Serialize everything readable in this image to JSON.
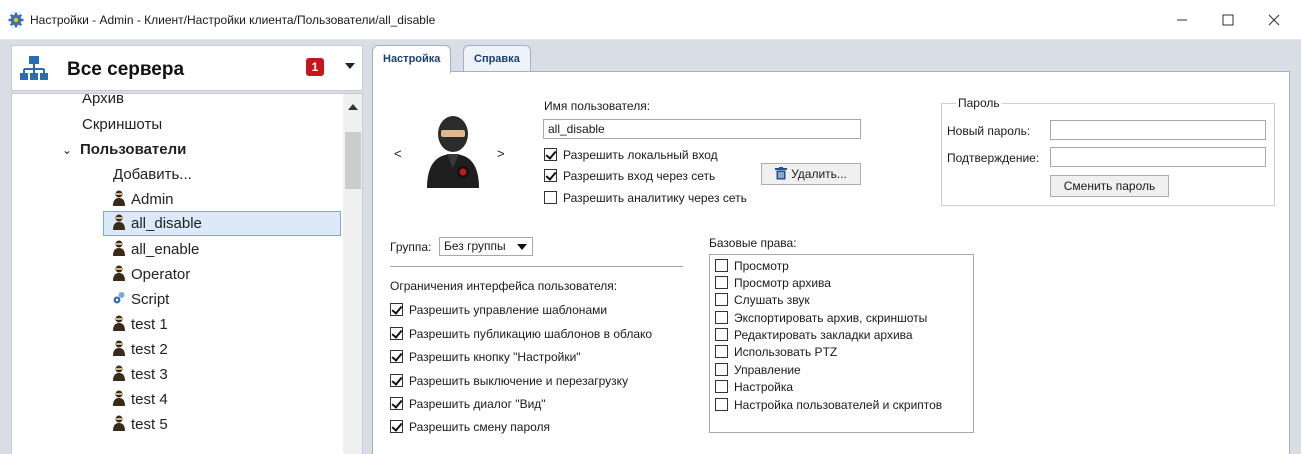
{
  "window": {
    "title": "Настройки - Admin - Клиент/Настройки клиента/Пользователи/all_disable"
  },
  "server_panel": {
    "title": "Все сервера",
    "badge": "1"
  },
  "tree": {
    "items": [
      {
        "label": "Архив"
      },
      {
        "label": "Скриншоты"
      },
      {
        "label": "Пользователи"
      },
      {
        "label": "Добавить..."
      },
      {
        "label": "Admin"
      },
      {
        "label": "all_disable"
      },
      {
        "label": "all_enable"
      },
      {
        "label": "Operator"
      },
      {
        "label": "Script"
      },
      {
        "label": "test 1"
      },
      {
        "label": "test 2"
      },
      {
        "label": "test 3"
      },
      {
        "label": "test 4"
      },
      {
        "label": "test 5"
      }
    ]
  },
  "tabs": [
    {
      "label": "Настройка"
    },
    {
      "label": "Справка"
    }
  ],
  "user": {
    "name_label": "Имя пользователя:",
    "name_value": "all_disable",
    "prev": "<",
    "next": ">",
    "allow_local_login": "Разрешить локальный вход",
    "allow_network_login": "Разрешить вход через сеть",
    "allow_network_analytics": "Разрешить аналитику через сеть",
    "delete_button": "Удалить..."
  },
  "password": {
    "group_title": "Пароль",
    "new_label": "Новый пароль:",
    "confirm_label": "Подтверждение:",
    "change_button": "Сменить пароль"
  },
  "group": {
    "label": "Группа:",
    "value": "Без группы"
  },
  "ui_limits": {
    "title": "Ограничения интерфейса пользователя:",
    "items": [
      {
        "label": "Разрешить управление шаблонами",
        "checked": true
      },
      {
        "label": "Разрешить публикацию шаблонов в облако",
        "checked": true
      },
      {
        "label": "Разрешить кнопку \"Настройки\"",
        "checked": true
      },
      {
        "label": "Разрешить выключение и перезагрузку",
        "checked": true
      },
      {
        "label": "Разрешить диалог \"Вид\"",
        "checked": true
      },
      {
        "label": "Разрешить смену пароля",
        "checked": true
      }
    ]
  },
  "base_rights": {
    "title": "Базовые права:",
    "items": [
      {
        "label": "Просмотр"
      },
      {
        "label": "Просмотр архива"
      },
      {
        "label": "Слушать звук"
      },
      {
        "label": "Экспортировать архив, скриншоты"
      },
      {
        "label": "Редактировать закладки архива"
      },
      {
        "label": "Использовать PTZ"
      },
      {
        "label": "Управление"
      },
      {
        "label": "Настройка"
      },
      {
        "label": "Настройка пользователей и скриптов"
      }
    ]
  }
}
